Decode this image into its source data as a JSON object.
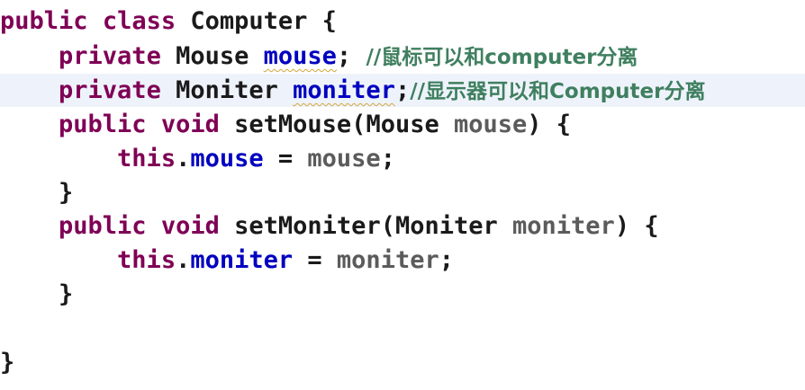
{
  "editor": {
    "lines": [
      {
        "kw1": "public",
        "kw2": "class",
        "name": "Computer",
        "brace": "{"
      },
      {
        "kw": "private",
        "type": "Mouse",
        "field": "mouse",
        "semi": ";",
        "comment": "//鼠标可以和computer分离"
      },
      {
        "kw": "private",
        "type": "Moniter",
        "field": "moniter",
        "semi": ";",
        "comment": "//显示器可以和Computer分离"
      },
      {
        "kw1": "public",
        "kw2": "void",
        "method": "setMouse(",
        "ptype": "Mouse",
        "param": "mouse",
        "tail": ") {"
      },
      {
        "this": "this",
        "dot": ".",
        "field": "mouse",
        "op": " = ",
        "value": "mouse",
        "semi": ";"
      },
      {
        "brace": "}"
      },
      {
        "kw1": "public",
        "kw2": "void",
        "method": "setMoniter(",
        "ptype": "Moniter",
        "param": "moniter",
        "tail": ") {"
      },
      {
        "this": "this",
        "dot": ".",
        "field": "moniter",
        "op": " = ",
        "value": "moniter",
        "semi": ";"
      },
      {
        "brace": "}"
      },
      {
        "brace": "}"
      }
    ]
  }
}
